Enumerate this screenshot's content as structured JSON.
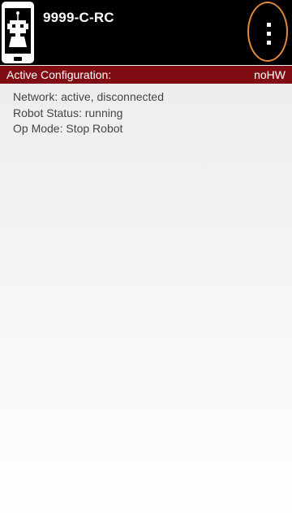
{
  "header": {
    "app_icon": "robot-phone-icon",
    "title": "9999-C-RC",
    "menu_icon": "overflow-menu-icon"
  },
  "config_bar": {
    "label": "Active Configuration:",
    "value": "noHW"
  },
  "status": {
    "network": "Network: active, disconnected",
    "robot_status": "Robot Status: running",
    "op_mode": "Op Mode: Stop Robot"
  },
  "colors": {
    "topbar": "#000000",
    "config_bar": "#7f0d13",
    "highlight": "#e2893a"
  }
}
